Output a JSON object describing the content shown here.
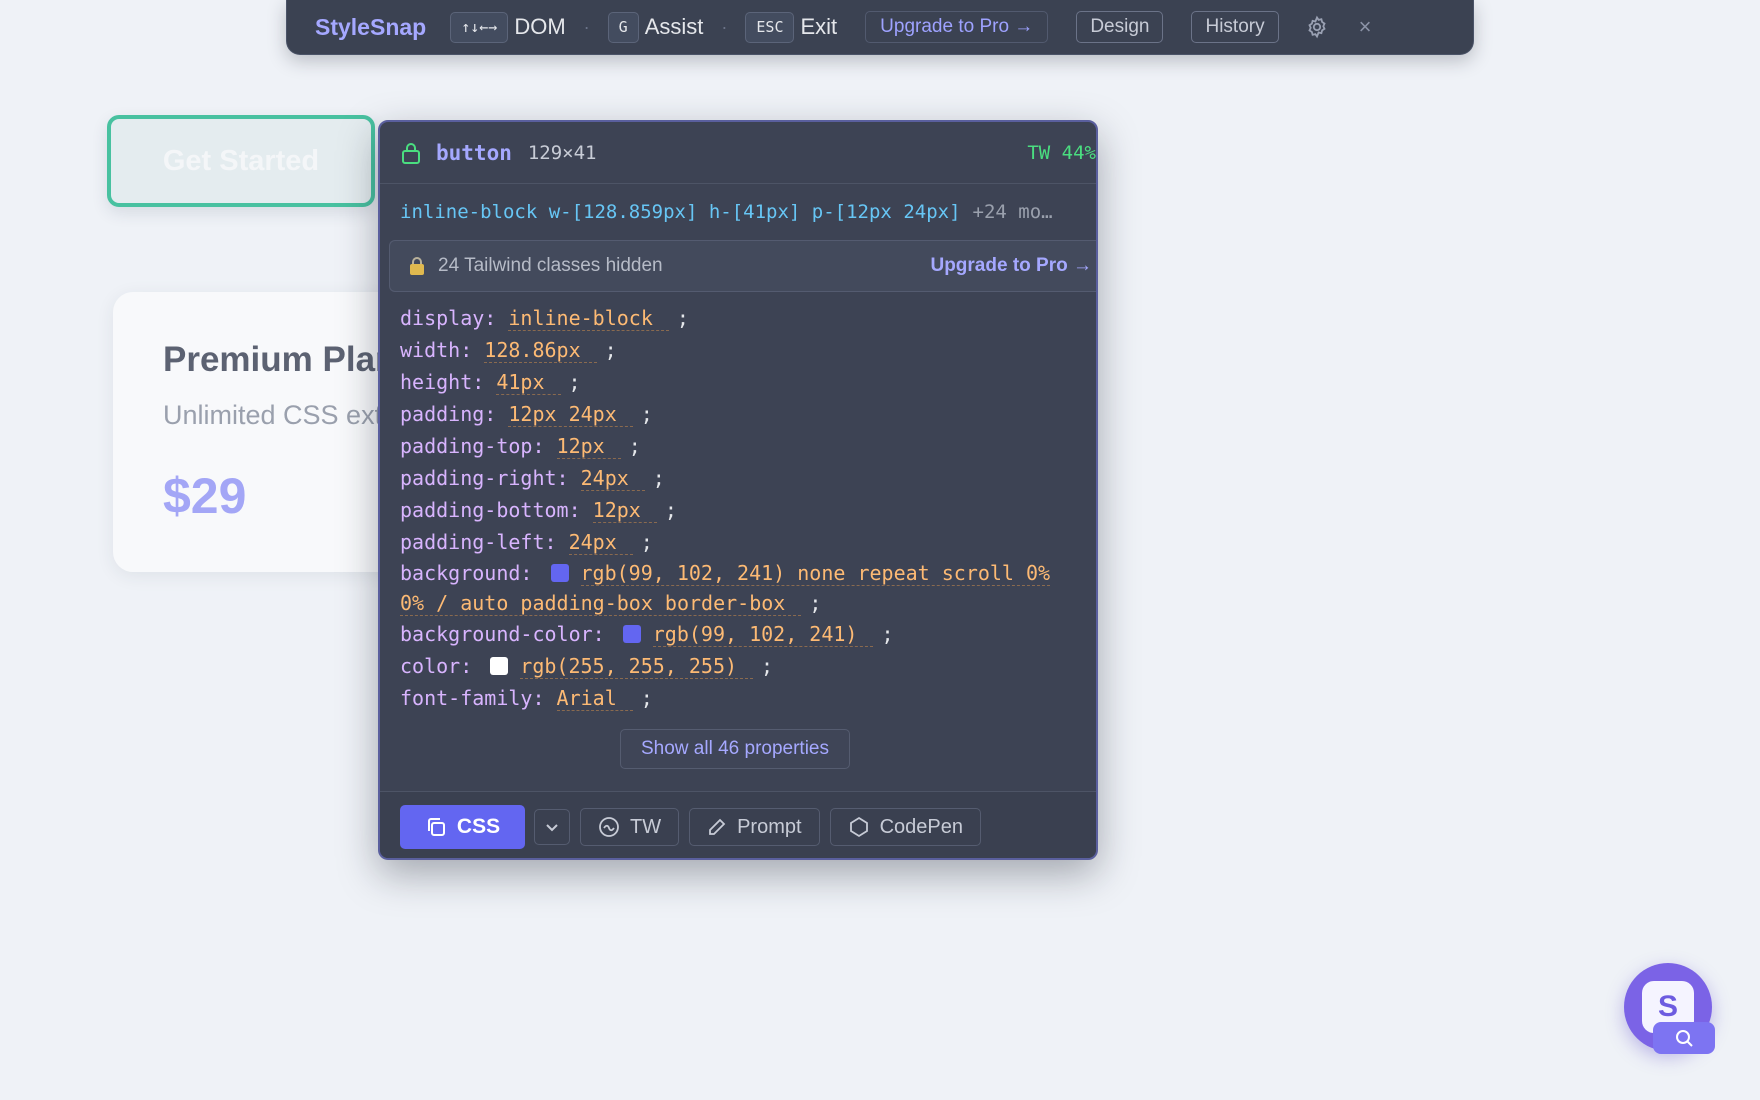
{
  "toolbar": {
    "brand": "StyleSnap",
    "shortcuts": [
      {
        "key": "↑↓←→",
        "label": "DOM"
      },
      {
        "key": "G",
        "label": "Assist"
      },
      {
        "key": "ESC",
        "label": "Exit"
      }
    ],
    "separator": "·",
    "upgrade_label": "Upgrade to Pro →",
    "design_label": "Design",
    "history_label": "History",
    "close_label": "×"
  },
  "page": {
    "cta_label": "Get Started",
    "card": {
      "title": "Premium Plan",
      "subtitle": "Unlimited CSS extraction & export",
      "price": "$29"
    }
  },
  "inspector": {
    "tag": "button",
    "size": "129×41",
    "tw_badge": "TW 44%",
    "tailwind_classes": "inline-block w-[128.859px] h-[41px] p-[12px 24px]",
    "more_label": "+24 mo…",
    "locked_text": "24 Tailwind classes hidden",
    "locked_upgrade": "Upgrade to Pro →",
    "properties": [
      {
        "name": "display:",
        "value": "inline-block"
      },
      {
        "name": "width:",
        "value": "128.86px"
      },
      {
        "name": "height:",
        "value": "41px"
      },
      {
        "name": "padding:",
        "value": "12px 24px"
      },
      {
        "name": "padding-top:",
        "value": "12px"
      },
      {
        "name": "padding-right:",
        "value": "24px"
      },
      {
        "name": "padding-bottom:",
        "value": "12px"
      },
      {
        "name": "padding-left:",
        "value": "24px"
      },
      {
        "name": "background:",
        "value": "rgb(99, 102, 241) none repeat scroll 0% 0% / auto padding-box border-box",
        "swatch": "#6366f1"
      },
      {
        "name": "background-color:",
        "value": "rgb(99, 102, 241)",
        "swatch": "#6366f1"
      },
      {
        "name": "color:",
        "value": "rgb(255, 255, 255)",
        "swatch": "#ffffff"
      },
      {
        "name": "font-family:",
        "value": "Arial"
      }
    ],
    "semicolon": ";",
    "show_all_label": "Show all 46 properties",
    "footer": {
      "css_label": "CSS",
      "tw_label": "TW",
      "prompt_label": "Prompt",
      "codepen_label": "CodePen"
    }
  },
  "fab": {
    "letter": "S"
  },
  "colors": {
    "accent": "#6366f1",
    "brand": "#a5a8ff",
    "tw_badge": "#4ade80",
    "focus_ring": "#48c1a0"
  }
}
